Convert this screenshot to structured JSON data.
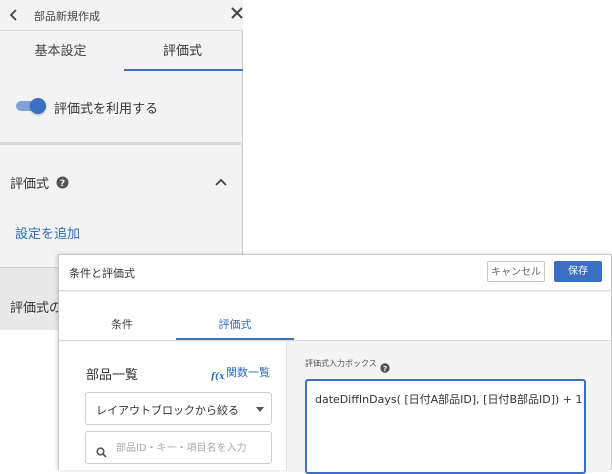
{
  "panel": {
    "title": "部品新規作成",
    "tabs": [
      {
        "label": "基本設定"
      },
      {
        "label": "評価式"
      }
    ],
    "toggle": {
      "label": "評価式を利用する",
      "on": true
    },
    "section": {
      "title": "評価式",
      "add_link": "設定を追加"
    },
    "bottom_text": "評価式の"
  },
  "modal": {
    "title": "条件と評価式",
    "cancel_label": "キャンセル",
    "save_label": "保存",
    "tabs": [
      {
        "label": "条件"
      },
      {
        "label": "評価式"
      }
    ],
    "parts_list": {
      "title": "部品一覧",
      "functions_link": "関数一覧",
      "select_value": "レイアウトブロックから絞る",
      "search_placeholder": "部品ID・キー・項目名を入力"
    },
    "formula": {
      "label": "評価式入力ボックス",
      "value": "dateDiffInDays( [日付A部品ID], [日付B部品ID]) + 1"
    }
  },
  "colors": {
    "accent": "#3b6fc4",
    "link": "#2e6cba"
  },
  "icons": [
    "chevron-left-icon",
    "close-icon",
    "help-icon",
    "chevron-up-icon",
    "function-icon",
    "search-icon",
    "caret-down-icon"
  ]
}
